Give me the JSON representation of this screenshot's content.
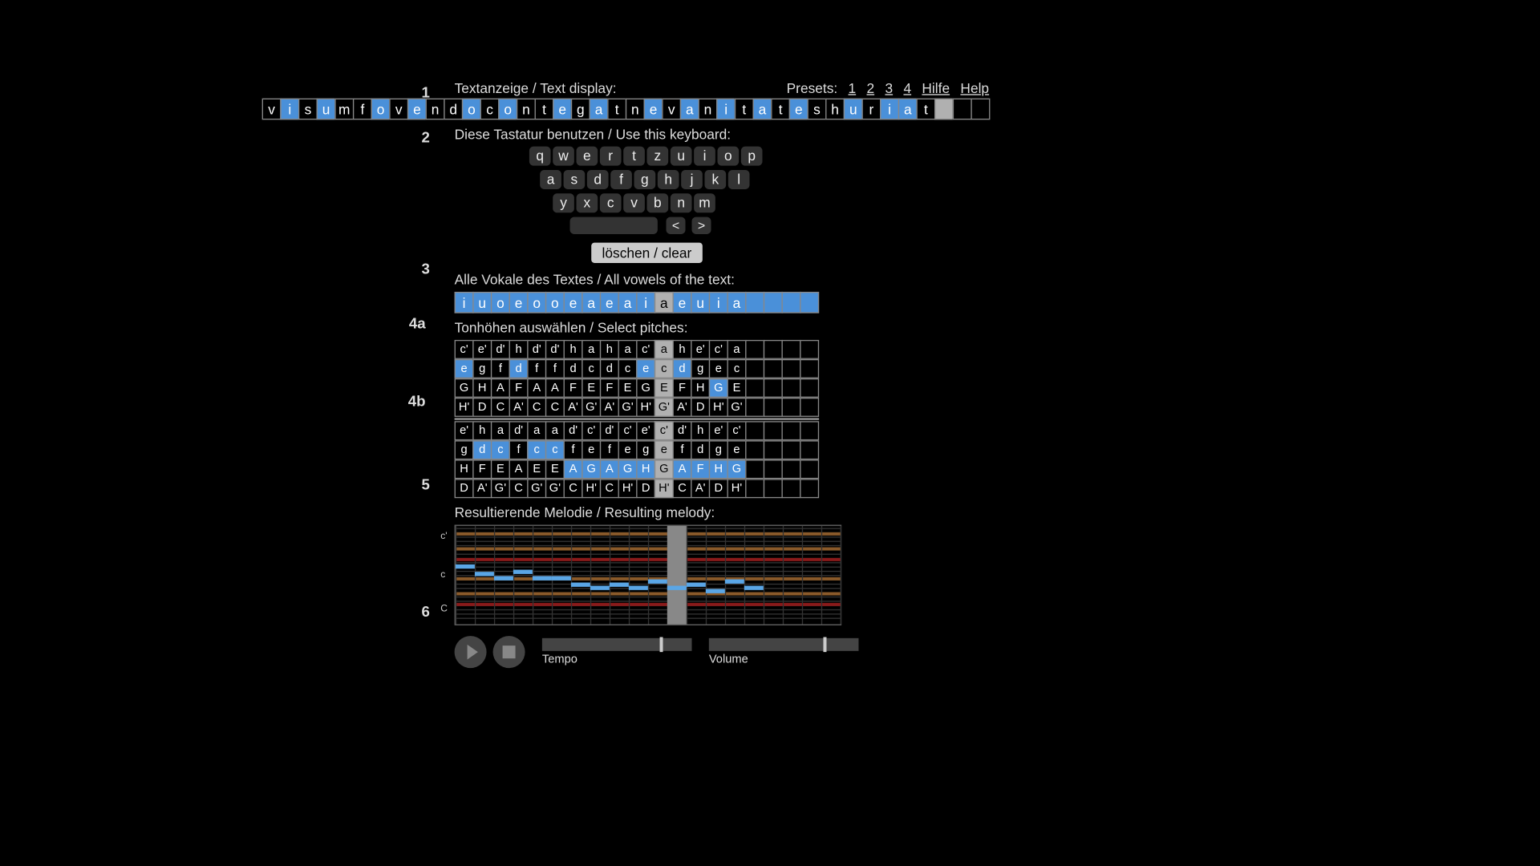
{
  "header": {
    "text_display_label": "Textanzeige / Text display:",
    "presets_label": "Presets:",
    "presets": [
      "1",
      "2",
      "3",
      "4"
    ],
    "hilfe": "Hilfe",
    "help": "Help"
  },
  "section_numbers": {
    "s1": "1",
    "s2": "2",
    "s3": "3",
    "s4a": "4a",
    "s4b": "4b",
    "s5": "5",
    "s6": "6"
  },
  "text_row": {
    "chars": [
      "v",
      "i",
      "s",
      "u",
      "m",
      "f",
      "o",
      "v",
      "e",
      "n",
      "d",
      "o",
      "c",
      "o",
      "n",
      "t",
      "e",
      "g",
      "a",
      "t",
      "n",
      "e",
      "v",
      "a",
      "n",
      "i",
      "t",
      "a",
      "t",
      "e",
      "s",
      "h",
      "u",
      "r",
      "i",
      "a",
      "t",
      "",
      "",
      ""
    ],
    "vowel_flags": [
      0,
      1,
      0,
      1,
      0,
      0,
      1,
      0,
      1,
      0,
      0,
      1,
      0,
      1,
      0,
      0,
      1,
      0,
      1,
      0,
      0,
      1,
      0,
      1,
      0,
      1,
      0,
      1,
      0,
      1,
      0,
      0,
      1,
      0,
      1,
      1,
      0,
      0,
      0,
      0
    ],
    "focus_index": 37
  },
  "keyboard": {
    "label": "Diese Tastatur benutzen / Use this keyboard:",
    "row1": [
      "q",
      "w",
      "e",
      "r",
      "t",
      "z",
      "u",
      "i",
      "o",
      "p"
    ],
    "row2": [
      "a",
      "s",
      "d",
      "f",
      "g",
      "h",
      "j",
      "k",
      "l"
    ],
    "row3": [
      "y",
      "x",
      "c",
      "v",
      "b",
      "n",
      "m"
    ],
    "back": "<",
    "fwd": ">",
    "clear": "löschen / clear"
  },
  "vowels": {
    "label": "Alle Vokale des Textes / All vowels of the text:",
    "cells": [
      "i",
      "u",
      "o",
      "e",
      "o",
      "o",
      "e",
      "a",
      "e",
      "a",
      "i",
      "a",
      "e",
      "u",
      "i",
      "a",
      "",
      "",
      "",
      ""
    ],
    "focus_index": 11
  },
  "pitches": {
    "label": "Tonhöhen auswählen / Select pitches:",
    "cols": 20,
    "focus_index": 11,
    "group_a": [
      {
        "vals": [
          "c'",
          "e'",
          "d'",
          "h",
          "d'",
          "d'",
          "h",
          "a",
          "h",
          "a",
          "c'",
          "a",
          "h",
          "e'",
          "c'",
          "a",
          "",
          "",
          "",
          ""
        ],
        "sel": []
      },
      {
        "vals": [
          "e",
          "g",
          "f",
          "d",
          "f",
          "f",
          "d",
          "c",
          "d",
          "c",
          "e",
          "c",
          "d",
          "g",
          "e",
          "c",
          "",
          "",
          "",
          ""
        ],
        "sel": [
          0,
          3,
          10,
          12
        ]
      },
      {
        "vals": [
          "G",
          "H",
          "A",
          "F",
          "A",
          "A",
          "F",
          "E",
          "F",
          "E",
          "G",
          "E",
          "F",
          "H",
          "G",
          "E",
          "",
          "",
          "",
          ""
        ],
        "sel": [
          14
        ]
      },
      {
        "vals": [
          "H'",
          "D",
          "C",
          "A'",
          "C",
          "C",
          "A'",
          "G'",
          "A'",
          "G'",
          "H'",
          "G'",
          "A'",
          "D",
          "H'",
          "G'",
          "",
          "",
          "",
          ""
        ],
        "sel": []
      }
    ],
    "group_b": [
      {
        "vals": [
          "e'",
          "h",
          "a",
          "d'",
          "a",
          "a",
          "d'",
          "c'",
          "d'",
          "c'",
          "e'",
          "c'",
          "d'",
          "h",
          "e'",
          "c'",
          "",
          "",
          "",
          ""
        ],
        "sel": []
      },
      {
        "vals": [
          "g",
          "d",
          "c",
          "f",
          "c",
          "c",
          "f",
          "e",
          "f",
          "e",
          "g",
          "e",
          "f",
          "d",
          "g",
          "e",
          "",
          "",
          "",
          ""
        ],
        "sel": [
          1,
          2,
          4,
          5,
          11
        ]
      },
      {
        "vals": [
          "H",
          "F",
          "E",
          "A",
          "E",
          "E",
          "A",
          "G",
          "A",
          "G",
          "H",
          "G",
          "A",
          "F",
          "H",
          "G",
          "",
          "",
          "",
          ""
        ],
        "sel": [
          6,
          7,
          8,
          9,
          10,
          12,
          13,
          14,
          15
        ]
      },
      {
        "vals": [
          "D",
          "A'",
          "G'",
          "C",
          "G'",
          "G'",
          "C",
          "H'",
          "C",
          "H'",
          "D",
          "H'",
          "C",
          "A'",
          "D",
          "H'",
          "",
          "",
          "",
          ""
        ],
        "sel": []
      }
    ]
  },
  "melody": {
    "label": "Resultierende Melodie / Resulting melody:",
    "axis_top": "c'",
    "axis_mid": "c",
    "axis_bot": "C",
    "notes_y": [
      36,
      43,
      47,
      41,
      47,
      47,
      53,
      56,
      53,
      56,
      50,
      56,
      53,
      59,
      50,
      56
    ],
    "focus_index": 11
  },
  "controls": {
    "tempo_label": "Tempo",
    "volume_label": "Volume",
    "tempo_pos": 0.8,
    "volume_pos": 0.78
  }
}
